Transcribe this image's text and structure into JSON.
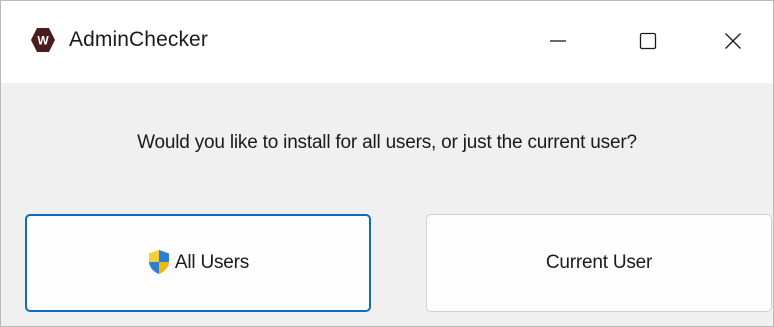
{
  "window": {
    "title": "AdminChecker",
    "app_icon": "w-hexagon-icon",
    "controls": {
      "minimize": "minimize-icon",
      "maximize": "maximize-icon",
      "close": "close-icon"
    }
  },
  "dialog": {
    "prompt": "Would you like to install for all users, or just the current user?",
    "buttons": {
      "all_users": {
        "label": "All Users",
        "icon": "uac-shield-icon",
        "focused": true
      },
      "current_user": {
        "label": "Current User"
      }
    }
  },
  "colors": {
    "accent": "#0f6cbd",
    "client_background": "#f0f0f0",
    "titlebar_background": "#ffffff",
    "app_icon": "#5a1e1e"
  }
}
